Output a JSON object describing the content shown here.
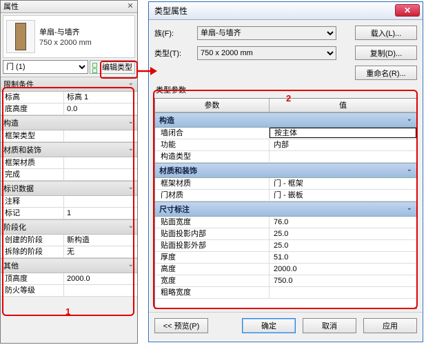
{
  "accent_red": "#e00000",
  "props": {
    "title": "属性",
    "family_name": "单扇-与墙齐",
    "type_size": "750 x 2000 mm",
    "selector": "门 (1)",
    "edit_type_btn": "编辑类型",
    "sections": {
      "constraints": {
        "label": "限制条件",
        "rows": [
          {
            "k": "标高",
            "v": "标高 1"
          },
          {
            "k": "底高度",
            "v": "0.0"
          }
        ]
      },
      "construction": {
        "label": "构造",
        "rows": [
          {
            "k": "框架类型",
            "v": ""
          }
        ]
      },
      "materials": {
        "label": "材质和装饰",
        "rows": [
          {
            "k": "框架材质",
            "v": ""
          },
          {
            "k": "完成",
            "v": ""
          }
        ]
      },
      "identity": {
        "label": "标识数据",
        "rows": [
          {
            "k": "注释",
            "v": ""
          },
          {
            "k": "标记",
            "v": "1"
          }
        ]
      },
      "phasing": {
        "label": "阶段化",
        "rows": [
          {
            "k": "创建的阶段",
            "v": "新构造"
          },
          {
            "k": "拆除的阶段",
            "v": "无"
          }
        ]
      },
      "other": {
        "label": "其他",
        "rows": [
          {
            "k": "顶高度",
            "v": "2000.0"
          },
          {
            "k": "防火等级",
            "v": ""
          }
        ]
      }
    }
  },
  "annotations": {
    "one": "1",
    "two": "2"
  },
  "dialog": {
    "title": "类型属性",
    "family_label": "族(F):",
    "family_value": "单扇-与墙齐",
    "type_label": "类型(T):",
    "type_value": "750 x 2000 mm",
    "load_btn": "载入(L)...",
    "dup_btn": "复制(D)...",
    "rename_btn": "重命名(R)...",
    "type_params_label": "类型参数",
    "col_param": "参数",
    "col_value": "值",
    "sections": {
      "construction": {
        "label": "构造",
        "rows": [
          {
            "p": "墙闭合",
            "v": "按主体",
            "selected": true
          },
          {
            "p": "功能",
            "v": "内部"
          },
          {
            "p": "构造类型",
            "v": ""
          }
        ]
      },
      "materials": {
        "label": "材质和装饰",
        "rows": [
          {
            "p": "框架材质",
            "v": "门 - 框架"
          },
          {
            "p": "门材质",
            "v": "门 - 嵌板"
          }
        ]
      },
      "dimensions": {
        "label": "尺寸标注",
        "rows": [
          {
            "p": "贴面宽度",
            "v": "76.0"
          },
          {
            "p": "贴面投影内部",
            "v": "25.0"
          },
          {
            "p": "贴面投影外部",
            "v": "25.0"
          },
          {
            "p": "厚度",
            "v": "51.0"
          },
          {
            "p": "高度",
            "v": "2000.0"
          },
          {
            "p": "宽度",
            "v": "750.0"
          },
          {
            "p": "粗略宽度",
            "v": ""
          }
        ]
      }
    },
    "preview_btn": "<< 预览(P)",
    "ok_btn": "确定",
    "cancel_btn": "取消",
    "apply_btn": "应用"
  }
}
